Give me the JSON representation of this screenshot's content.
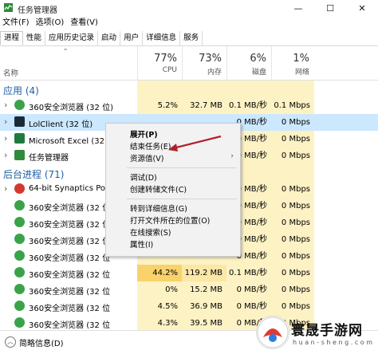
{
  "window": {
    "title": "任务管理器",
    "controls": [
      "—",
      "☐",
      "✕"
    ]
  },
  "menu": [
    "文件(F)",
    "选项(O)",
    "查看(V)"
  ],
  "tabs": [
    "进程",
    "性能",
    "应用历史记录",
    "启动",
    "用户",
    "详细信息",
    "服务"
  ],
  "active_tab": 0,
  "columns": {
    "name_label": "名称",
    "cpu": {
      "pct": "77%",
      "label": "CPU"
    },
    "mem": {
      "pct": "73%",
      "label": "内存"
    },
    "disk": {
      "pct": "6%",
      "label": "磁盘"
    },
    "net": {
      "pct": "1%",
      "label": "网络"
    }
  },
  "groups": {
    "apps": "应用 (4)",
    "background": "后台进程 (71)"
  },
  "rows": [
    {
      "type": "group",
      "key": "apps"
    },
    {
      "name": "360安全浏览器 (32 位)",
      "exp": true,
      "icon": "browser-icon",
      "cpu": "5.2%",
      "mem": "32.7 MB",
      "disk": "0.1 MB/秒",
      "net": "0.1 Mbps"
    },
    {
      "name": "LolClient (32 位)",
      "exp": true,
      "icon": "lol-icon",
      "selected": true,
      "cpu": "",
      "mem": "",
      "disk": "0 MB/秒",
      "net": "0 Mbps"
    },
    {
      "name": "Microsoft Excel (32 位)",
      "exp": true,
      "icon": "excel-icon",
      "cpu": "",
      "mem": "",
      "disk": "0 MB/秒",
      "net": "0 Mbps"
    },
    {
      "name": "任务管理器",
      "exp": true,
      "icon": "taskmgr-icon",
      "cpu": "",
      "mem": "",
      "disk": "0 MB/秒",
      "net": "0 Mbps"
    },
    {
      "type": "group",
      "key": "background"
    },
    {
      "name": "64-bit Synaptics Pointin",
      "exp": true,
      "icon": "synaptics-icon",
      "cpu": "",
      "mem": "",
      "disk": "0 MB/秒",
      "net": "0 Mbps"
    },
    {
      "name": "360安全浏览器 (32 位",
      "exp": false,
      "icon": "browser-icon",
      "cpu": "",
      "mem": "",
      "disk": "0 MB/秒",
      "net": "0 Mbps"
    },
    {
      "name": "360安全浏览器 (32 位",
      "exp": false,
      "icon": "browser-icon",
      "cpu": "",
      "mem": "",
      "disk": "0 MB/秒",
      "net": "0 Mbps"
    },
    {
      "name": "360安全浏览器 (32 位",
      "exp": false,
      "icon": "browser-icon",
      "cpu": "",
      "mem": "",
      "disk": "0 MB/秒",
      "net": "0 Mbps"
    },
    {
      "name": "360安全浏览器 (32 位",
      "exp": false,
      "icon": "browser-icon",
      "cpu": "",
      "mem": "",
      "disk": "0 MB/秒",
      "net": "0 Mbps"
    },
    {
      "name": "360安全浏览器 (32 位",
      "exp": false,
      "icon": "browser-icon",
      "cpu": "44.2%",
      "mem": "119.2 MB",
      "disk": "0.1 MB/秒",
      "net": "0 Mbps",
      "hotcpu": true
    },
    {
      "name": "360安全浏览器 (32 位",
      "exp": false,
      "icon": "browser-icon",
      "cpu": "0%",
      "mem": "15.2 MB",
      "disk": "0 MB/秒",
      "net": "0 Mbps"
    },
    {
      "name": "360安全浏览器 (32 位",
      "exp": false,
      "icon": "browser-icon",
      "cpu": "4.5%",
      "mem": "36.9 MB",
      "disk": "0 MB/秒",
      "net": "0 Mbps"
    },
    {
      "name": "360安全浏览器 (32 位",
      "exp": false,
      "icon": "browser-icon",
      "cpu": "4.3%",
      "mem": "39.5 MB",
      "disk": "0 MB/秒",
      "net": "0 Mbps"
    }
  ],
  "context_menu": {
    "items": [
      {
        "label": "展开(P)",
        "bold": true
      },
      {
        "label": "结束任务(E)"
      },
      {
        "label": "资源值(V)",
        "submenu": true
      },
      {
        "sep": true
      },
      {
        "label": "调试(D)"
      },
      {
        "label": "创建转储文件(C)"
      },
      {
        "sep": true
      },
      {
        "label": "转到详细信息(G)"
      },
      {
        "label": "打开文件所在的位置(O)"
      },
      {
        "label": "在线搜索(S)"
      },
      {
        "label": "属性(I)"
      }
    ],
    "submenu_glyph": "›"
  },
  "footer": {
    "label": "简略信息(D)",
    "icon": "chevron-up-icon"
  },
  "watermark": {
    "title": "寰晟手游网",
    "subtitle": "h u a n - s h e n g . c o m"
  },
  "colors": {
    "accent": "#1f5fa0",
    "cpu_bg": "#fdf2c4",
    "hot_bg": "#f8d26a",
    "selected_bg": "#cce8ff",
    "arrow": "#b0202a"
  }
}
